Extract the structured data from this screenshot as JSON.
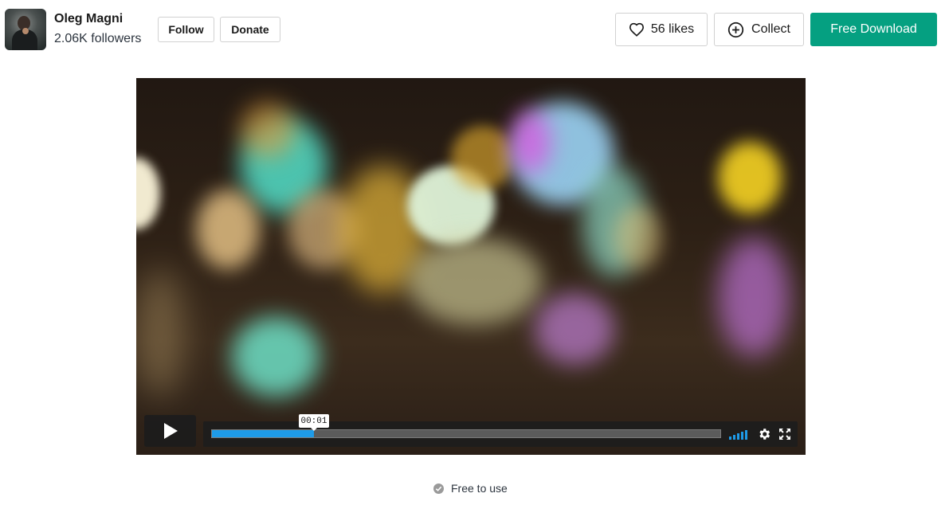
{
  "author": {
    "name": "Oleg Magni",
    "followers": "2.06K followers"
  },
  "actions": {
    "follow_label": "Follow",
    "donate_label": "Donate",
    "likes_label": "56 likes",
    "collect_label": "Collect",
    "download_label": "Free Download"
  },
  "player": {
    "time_tooltip": "00:01",
    "progress_fraction": 0.2,
    "accent_color": "#1e9be8"
  },
  "license": {
    "label": "Free to use"
  },
  "colors": {
    "download_bg": "#05a081"
  },
  "icons": [
    "heart-icon",
    "plus-circle-icon",
    "play-icon",
    "volume-icon",
    "gear-icon",
    "fullscreen-icon",
    "check-icon"
  ]
}
